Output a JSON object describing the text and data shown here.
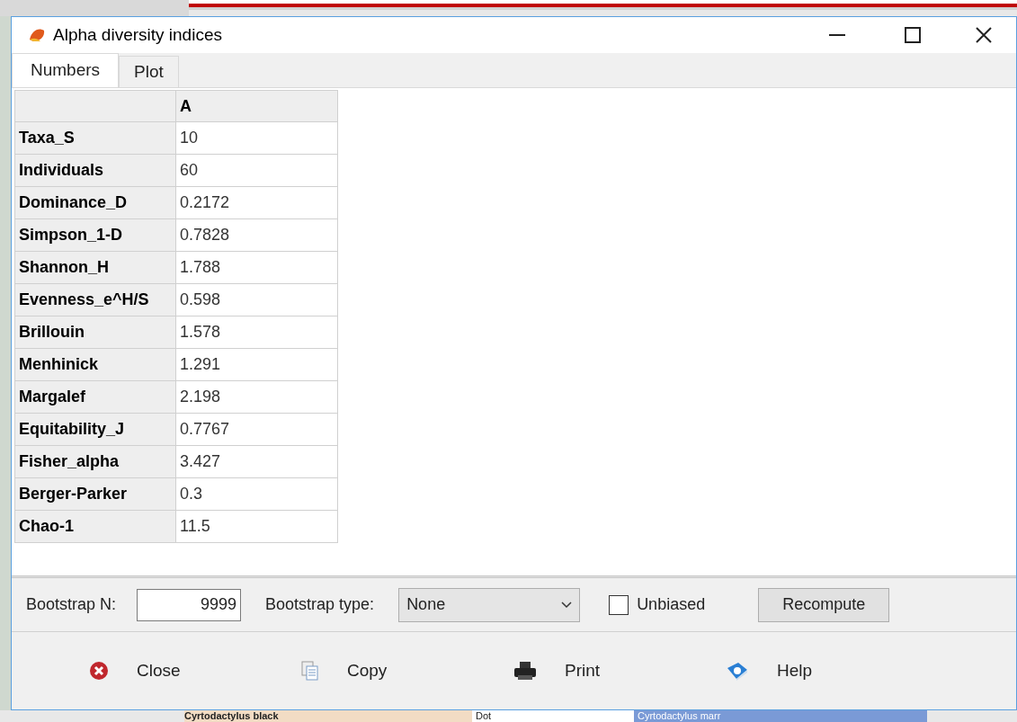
{
  "window": {
    "title": "Alpha diversity indices"
  },
  "tabs": [
    {
      "label": "Numbers",
      "selected": true
    },
    {
      "label": "Plot",
      "selected": false
    }
  ],
  "table": {
    "columns": [
      "A"
    ],
    "rows": [
      {
        "label": "Taxa_S",
        "value": "10"
      },
      {
        "label": "Individuals",
        "value": "60"
      },
      {
        "label": "Dominance_D",
        "value": "0.2172"
      },
      {
        "label": "Simpson_1-D",
        "value": "0.7828"
      },
      {
        "label": "Shannon_H",
        "value": "1.788"
      },
      {
        "label": "Evenness_e^H/S",
        "value": "0.598"
      },
      {
        "label": "Brillouin",
        "value": "1.578"
      },
      {
        "label": "Menhinick",
        "value": "1.291"
      },
      {
        "label": "Margalef",
        "value": "2.198"
      },
      {
        "label": "Equitability_J",
        "value": "0.7767"
      },
      {
        "label": "Fisher_alpha",
        "value": "3.427"
      },
      {
        "label": "Berger-Parker",
        "value": "0.3"
      },
      {
        "label": "Chao-1",
        "value": "11.5"
      }
    ]
  },
  "options": {
    "bootstrap_n_label": "Bootstrap N:",
    "bootstrap_n": "9999",
    "bootstrap_type_label": "Bootstrap type:",
    "bootstrap_type": "None",
    "unbiased": {
      "label": "Unbiased",
      "checked": false
    },
    "recompute": "Recompute"
  },
  "buttons": [
    {
      "kind": "close",
      "label": "Close"
    },
    {
      "kind": "copy",
      "label": "Copy"
    },
    {
      "kind": "print",
      "label": "Print"
    },
    {
      "kind": "help",
      "label": "Help"
    }
  ],
  "background_row": [
    "Cyrtodactylus black",
    "Dot",
    "Cyrtodactylus marr"
  ]
}
